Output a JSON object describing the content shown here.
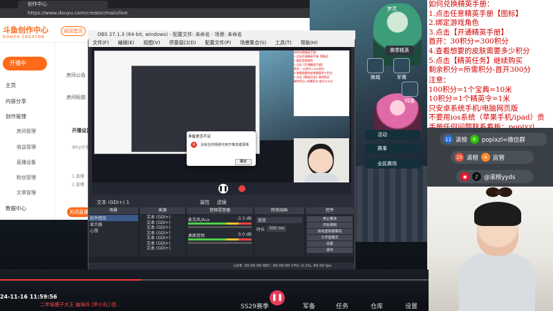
{
  "browser": {
    "tab_title": "创作中心",
    "url": "https://www.douyu.com/creator/main/live",
    "logo_text": "斗鱼创作中心",
    "logo_sub": "DOUYU CREATOR",
    "home_button": "返回首页",
    "live_button": "开播中",
    "side_items": [
      "主页",
      "内容分享",
      "创作管理",
      "数据中心"
    ],
    "side_sub_items": [
      "房间管理",
      "收益管理",
      "直播设备",
      "粉丝管理",
      "文章管理"
    ],
    "content_labels": [
      "房间公告",
      "房间标题",
      "开播设置",
      "Why分享",
      "1.直播",
      "2.直播"
    ],
    "section_title": "开播设置",
    "close_live_button": "关闭直播"
  },
  "obs": {
    "title": "OBS 27.1.3 (64-bit, windows) - 配置文件: 未命名 - 场景: 未命名",
    "menu": [
      "文件(F)",
      "编辑(E)",
      "视图(V)",
      "停靠窗口(D)",
      "配置文件(P)",
      "场景集合(S)",
      "工具(T)",
      "帮助(H)"
    ],
    "dialog_title": "准备是否不足",
    "dialog_message": "没有任何场景可用于推流或录像",
    "dialog_ok": "确定",
    "source_bar": "文本 (GDI+) 1",
    "source_tools": [
      "属性",
      "滤镜"
    ],
    "dock_headers": [
      "场景",
      "来源",
      "音频混音器",
      "转场动画",
      "控件"
    ],
    "scenes": [
      "和平精英",
      "显示器",
      "心想"
    ],
    "sources": [
      "文本 (GDI+)",
      "文本 (GDI+)",
      "文本 (GDI+)",
      "文本 (GDI+)",
      "文本 (GDI+)",
      "文本 (GDI+)",
      "文本 (GDI+)"
    ],
    "mixer": [
      {
        "name": "麦克风/Aux",
        "db": "-3.3 dB"
      },
      {
        "name": "桌面音频",
        "db": "0.0 dB"
      }
    ],
    "transition": {
      "type": "渐变",
      "duration_label": "时长",
      "duration_value": "300 ms"
    },
    "controls": [
      "停止推流",
      "开始录制",
      "启动虚拟摄像机",
      "工作室模式",
      "设置",
      "退出"
    ],
    "status": "LIVE: 00:00:00   REC: 00:00:00   CPU: 0.1%, 60.00 fps"
  },
  "rules": {
    "lines": [
      "如何兑换精英手册：",
      "1.点击任意精英手册【图标】",
      "2.绑定游戏角色",
      "3.点击【开通精英手册】",
      "   首开：30积分=300积分",
      "4.查看想要的皮肤需要多少积分",
      "5.点击【精英任务】继续购买",
      "剩余积分=所需积分-首开300分"
    ],
    "notes": [
      "注意：",
      "100积分=1个宝典=10米",
      "10积分=1个精英令=1米",
      "只安卓系统手机/电脑网页版",
      "不要用ios系统（苹果手机/ipad）贡",
      "手册任何问题联系看板：popixzl"
    ]
  },
  "socials": [
    {
      "icon": "wechat-icon",
      "num": "11",
      "label": "滚榜",
      "text": "popixzl=微信群"
    },
    {
      "icon": "fire-icon",
      "num": "25",
      "label": "滚榜",
      "text": "房管"
    },
    {
      "icon": "weibo-icon",
      "num": "",
      "label": "",
      "text": "@滚榜yyds"
    }
  ],
  "game": {
    "player_name": "梦灵",
    "buttons": [
      "商城",
      "军需",
      "特惠"
    ],
    "prize_button": "赛季精英",
    "list": [
      "活动",
      "赛事",
      "全民赛场"
    ]
  },
  "bottom": {
    "timestamp": "24-11-16 11:59:56",
    "subtitle": "二年级鹿子大王  幽骑兵 [甲小队] 团...",
    "labels": [
      "SS29赛季",
      "军备",
      "任务",
      "仓库",
      "设置"
    ],
    "progress": 0.33
  },
  "colors": {
    "accent": "#ff6a1a",
    "rule_red": "#d40000",
    "live_red": "#e83a5a"
  }
}
